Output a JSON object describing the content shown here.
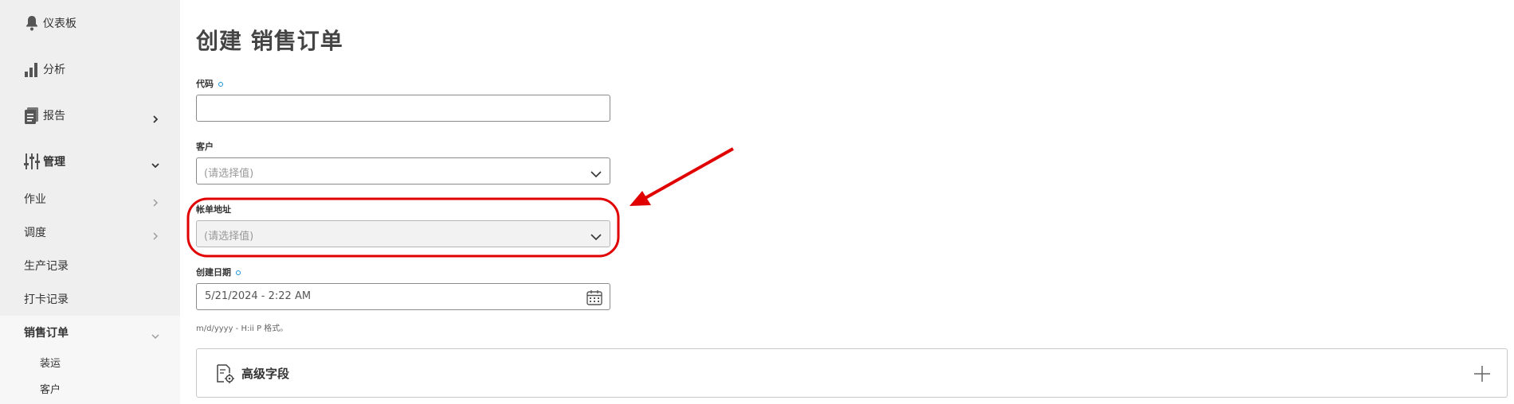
{
  "sidebar": {
    "main_items": [
      {
        "label": "仪表板",
        "icon": "bell-icon"
      },
      {
        "label": "分析",
        "icon": "bar-chart-icon"
      },
      {
        "label": "报告",
        "icon": "report-icon"
      },
      {
        "label": "管理",
        "icon": "sliders-icon"
      }
    ],
    "sub_items": [
      {
        "label": "作业"
      },
      {
        "label": "调度"
      },
      {
        "label": "生产记录"
      },
      {
        "label": "打卡记录"
      },
      {
        "label": "销售订单"
      }
    ],
    "sub_sub_items": [
      {
        "label": "装运"
      },
      {
        "label": "客户"
      }
    ]
  },
  "form": {
    "title": "创建 销售订单",
    "code": {
      "label": "代码",
      "value": ""
    },
    "customer": {
      "label": "客户",
      "placeholder": "(请选择值)"
    },
    "billing_address": {
      "label": "帐单地址",
      "placeholder": "(请选择值)"
    },
    "created_date": {
      "label": "创建日期",
      "value": "5/21/2024 - 2:22 AM",
      "hint": "m/d/yyyy - H:ii P 格式。"
    },
    "advanced": {
      "label": "高级字段"
    }
  },
  "colors": {
    "required_dot": "#1a8fd6",
    "annotation": "#e00000"
  }
}
